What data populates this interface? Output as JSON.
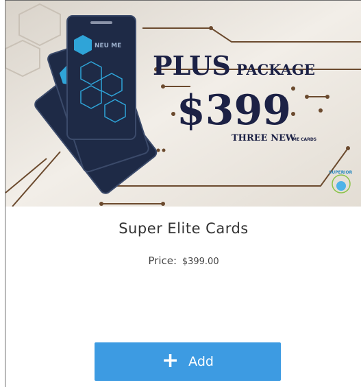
{
  "banner": {
    "headline_plus": "PLUS",
    "headline_package": "PACKAGE",
    "price": "$399",
    "subline_main": "THREE NEW",
    "subline_small": "ME CARDS",
    "card_brand": "NEU ME",
    "logo_text": "SUPERIOR",
    "colors": {
      "background": "#e7e1d8",
      "card": "#1e2a46",
      "accent": "#2fa4d8",
      "text": "#1c2145",
      "trace": "#6b4a2e"
    }
  },
  "product": {
    "title": "Super Elite Cards",
    "price_label": "Price:",
    "price_value": "$399.00"
  },
  "actions": {
    "add_label": "Add",
    "add_icon": "plus-icon",
    "add_color": "#3d9be2"
  }
}
